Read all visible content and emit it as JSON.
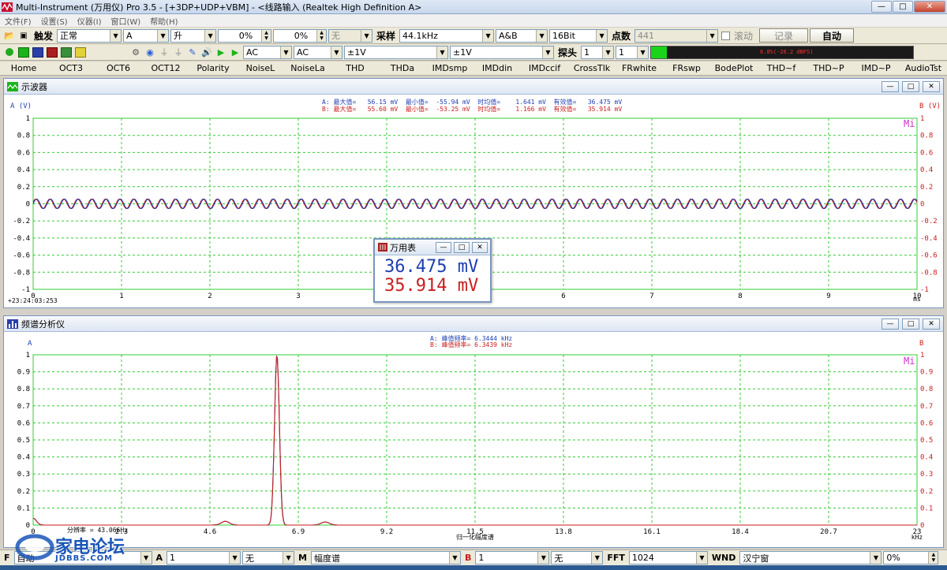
{
  "app": {
    "title": "Multi-Instrument (万用仪) Pro 3.5  - [+3DP+UDP+VBM]  - <线路输入 (Realtek High Definition A>",
    "win_min": "—",
    "win_max": "□",
    "win_close": "✕"
  },
  "menu": [
    "文件(F)",
    "设置(S)",
    "仪器(I)",
    "窗口(W)",
    "帮助(H)"
  ],
  "toolbar1": {
    "trigger_label": "触发",
    "trigger_mode": "正常",
    "trigger_channel": "A",
    "trigger_edge": "升",
    "level_value": "0%",
    "pretrig_value": "0%",
    "none_value": "无",
    "sample_label": "采样",
    "sample_rate": "44.1kHz",
    "channels": "A&B",
    "bits": "16Bit",
    "points_label": "点数",
    "points_value": "441",
    "scroll_label": "滚动",
    "record_button": "记录",
    "auto_button": "自动"
  },
  "toolbar2": {
    "coupling_a": "AC",
    "coupling_b": "AC",
    "range_a": "±1V",
    "range_b": "±1V",
    "probe_label": "探头",
    "probe_a": "1",
    "probe_b": "1",
    "level_readout": "6.8%(-26.2 dBFS)"
  },
  "tabs": [
    "Home",
    "OCT3",
    "OCT6",
    "OCT12",
    "Polarity",
    "NoiseL",
    "NoiseLa",
    "THD",
    "THDa",
    "IMDsmp",
    "IMDdin",
    "IMDccif",
    "CrossTlk",
    "FRwhite",
    "FRswp",
    "BodePlot",
    "THD~f",
    "THD~P",
    "IMD~P",
    "AudioTst"
  ],
  "oscilloscope": {
    "title": "示波器",
    "axis_left": "A (V)",
    "axis_right": "B (V)",
    "x_unit": "ms",
    "timestamp": "+23:24:03:253",
    "stats_a": "A: 最大值=   56.15 mV  最小值=  -55.94 mV  时均值=    1.641 mV  有效值=   36.475 mV",
    "stats_b": "B: 最大值=   55.60 mV  最小值=  -53.25 mV  时均值=    1.166 mV  有效值=   35.914 mV",
    "mi": "Mi",
    "y_ticks": [
      "1",
      "0.8",
      "0.6",
      "0.4",
      "0.2",
      "0",
      "-0.2",
      "-0.4",
      "-0.6",
      "-0.8",
      "-1"
    ],
    "x_ticks": [
      "0",
      "1",
      "2",
      "3",
      "4",
      "5",
      "6",
      "7",
      "8",
      "9",
      "10"
    ],
    "color_a": "#1f3fb0",
    "color_b": "#c81e1e",
    "grid_color": "#33cc33"
  },
  "meter": {
    "title": "万用表",
    "value_a": "36.475  mV",
    "value_b": "35.914  mV"
  },
  "spectrum": {
    "title": "频谱分析仪",
    "axis_left": "A",
    "axis_right": "B",
    "peak_a": "A: 峰值频率= 6.3444 kHz",
    "peak_b": "B: 峰值频率= 6.3439 kHz",
    "x_label": "归一化幅度谱",
    "x_unit": "kHz",
    "resolution": "分辨率 = 43.066Hz",
    "mi": "Mi",
    "y_ticks": [
      "1",
      "0.9",
      "0.8",
      "0.7",
      "0.6",
      "0.5",
      "0.4",
      "0.3",
      "0.2",
      "0.1",
      "0"
    ],
    "x_ticks": [
      "0",
      "2.3",
      "4.6",
      "6.9",
      "9.2",
      "11.5",
      "13.8",
      "16.1",
      "18.4",
      "20.7",
      "23"
    ]
  },
  "bottombar": {
    "f_label": "F",
    "f_mode": "自动",
    "a_label": "A",
    "a_value": "1",
    "a_none": "无",
    "m_label": "M",
    "m_value": "幅度谱",
    "b_label": "B",
    "b_value": "1",
    "b_none": "无",
    "fft_label": "FFT",
    "fft_value": "1024",
    "wnd_label": "WND",
    "wnd_value": "汉宁窗",
    "pct_value": "0%"
  },
  "watermark": {
    "text": "家电论坛",
    "sub": "JDBBS.COM"
  }
}
